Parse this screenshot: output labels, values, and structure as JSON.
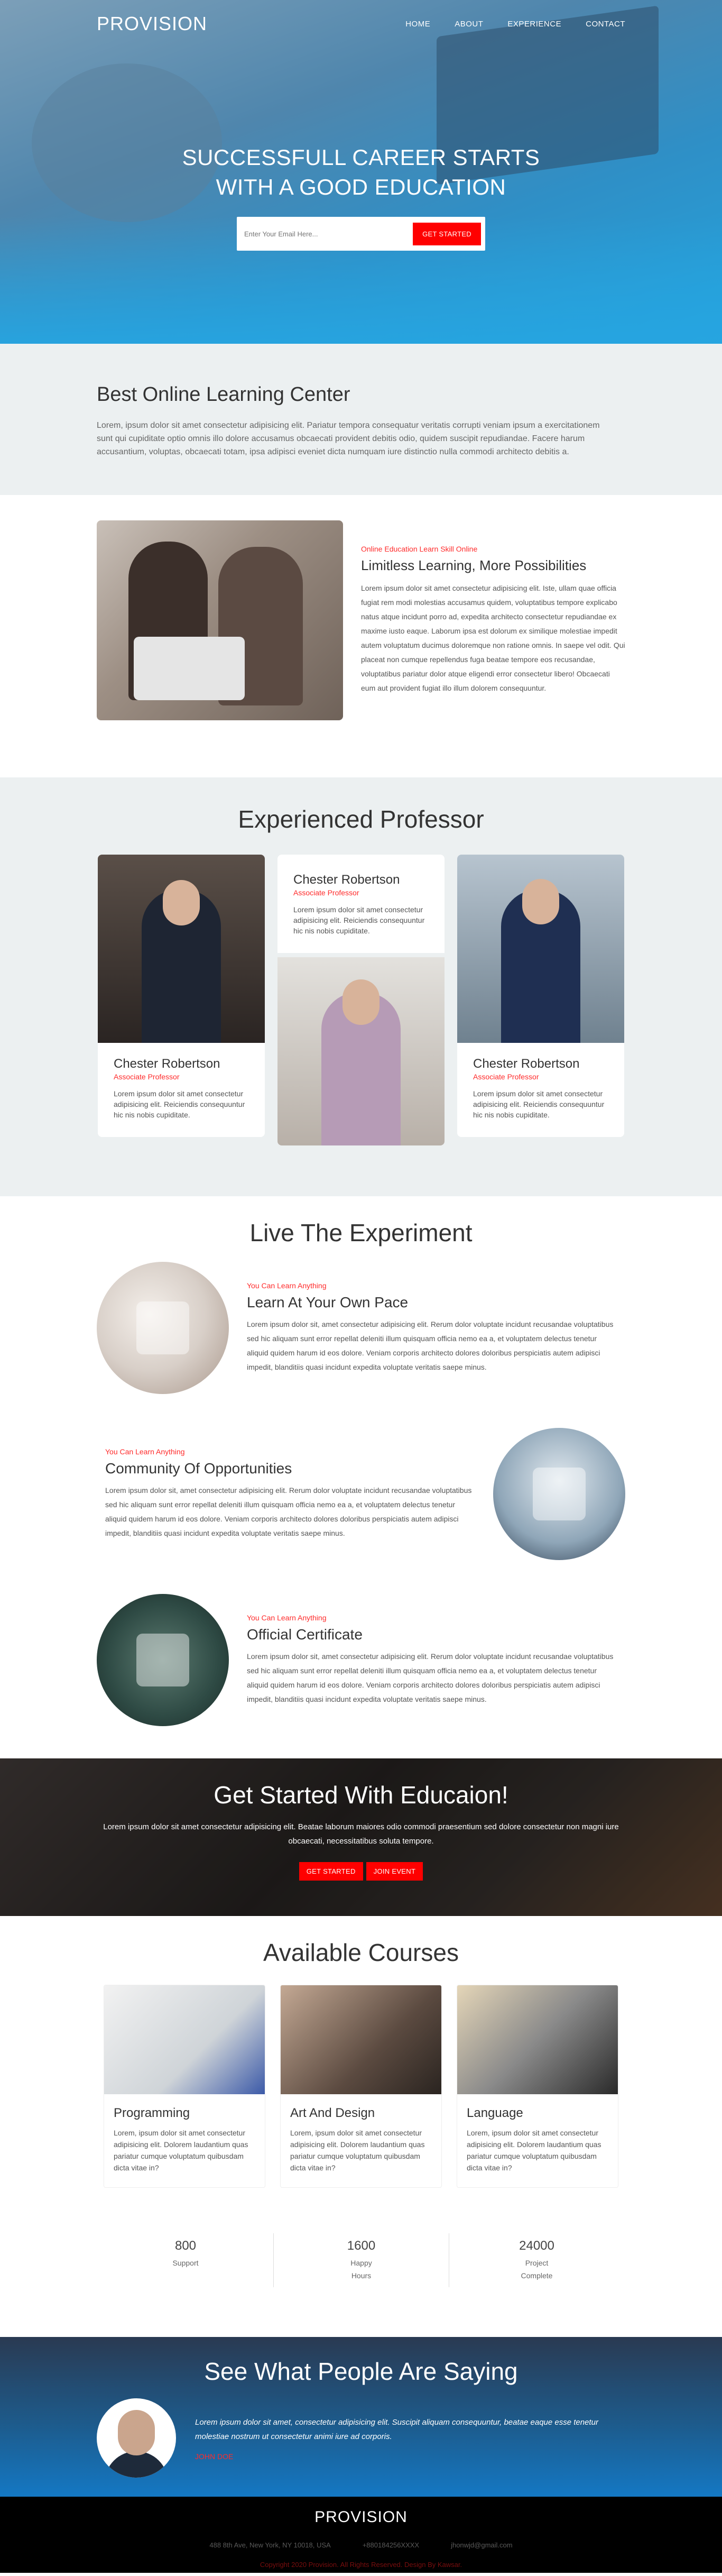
{
  "nav": {
    "logo": "PROVISION",
    "items": [
      "HOME",
      "ABOUT",
      "EXPERIENCE",
      "CONTACT"
    ]
  },
  "hero": {
    "title_line1": "SUCCESSFULL CAREER STARTS",
    "title_line2": "WITH A GOOD EDUCATION",
    "email_placeholder": "Enter Your Email Here...",
    "cta": "GET STARTED"
  },
  "online": {
    "title": "Best Online Learning Center",
    "text": "Lorem, ipsum dolor sit amet consectetur adipisicing elit. Pariatur tempora consequatur veritatis corrupti veniam ipsum a exercitationem sunt qui cupiditate optio omnis illo dolore accusamus obcaecati provident debitis odio, quidem suscipit repudiandae. Facere harum accusantium, voluptas, obcaecati totam, ipsa adipisci eveniet dicta numquam iure distinctio nulla commodi architecto debitis a."
  },
  "limitless": {
    "eyebrow": "Online Education Learn Skill Online",
    "title": "Limitless Learning, More Possibilities",
    "text": "Lorem ipsum dolor sit amet consectetur adipisicing elit. Iste, ullam quae officia fugiat rem modi molestias accusamus quidem, voluptatibus tempore explicabo natus atque incidunt porro ad, expedita architecto consectetur repudiandae ex maxime iusto eaque. Laborum ipsa est dolorum ex similique molestiae impedit autem voluptatum ducimus doloremque non ratione omnis. In saepe vel odit. Qui placeat non cumque repellendus fuga beatae tempore eos recusandae, voluptatibus pariatur dolor atque eligendi error consectetur libero! Obcaecati eum aut provident fugiat illo illum dolorem consequuntur."
  },
  "professors": {
    "title": "Experienced Professor",
    "items": [
      {
        "name": "Chester Robertson",
        "role": "Associate Professor",
        "text": "Lorem ipsum dolor sit amet consectetur adipisicing elit. Reiciendis consequuntur hic nis nobis cupiditate."
      },
      {
        "name": "Chester Robertson",
        "role": "Associate Professor",
        "text": "Lorem ipsum dolor sit amet consectetur adipisicing elit. Reiciendis consequuntur hic nis nobis cupiditate."
      },
      {
        "name": "Chester Robertson",
        "role": "Associate Professor",
        "text": "Lorem ipsum dolor sit amet consectetur adipisicing elit. Reiciendis consequuntur hic nis nobis cupiditate."
      }
    ]
  },
  "experiment": {
    "title": "Live The Experiment",
    "items": [
      {
        "eyebrow": "You Can Learn Anything",
        "title": "Learn At Your Own Pace",
        "text": "Lorem ipsum dolor sit, amet consectetur adipisicing elit. Rerum dolor voluptate incidunt recusandae voluptatibus sed hic aliquam sunt error repellat deleniti illum quisquam officia nemo ea a, et voluptatem delectus tenetur aliquid quidem harum id eos dolore. Veniam corporis architecto dolores doloribus perspiciatis autem adipisci impedit, blanditiis quasi incidunt expedita voluptate veritatis saepe minus."
      },
      {
        "eyebrow": "You Can Learn Anything",
        "title": "Community Of Opportunities",
        "text": "Lorem ipsum dolor sit, amet consectetur adipisicing elit. Rerum dolor voluptate incidunt recusandae voluptatibus sed hic aliquam sunt error repellat deleniti illum quisquam officia nemo ea a, et voluptatem delectus tenetur aliquid quidem harum id eos dolore. Veniam corporis architecto dolores doloribus perspiciatis autem adipisci impedit, blanditiis quasi incidunt expedita voluptate veritatis saepe minus."
      },
      {
        "eyebrow": "You Can Learn Anything",
        "title": "Official Certificate",
        "text": "Lorem ipsum dolor sit, amet consectetur adipisicing elit. Rerum dolor voluptate incidunt recusandae voluptatibus sed hic aliquam sunt error repellat deleniti illum quisquam officia nemo ea a, et voluptatem delectus tenetur aliquid quidem harum id eos dolore. Veniam corporis architecto dolores doloribus perspiciatis autem adipisci impedit, blanditiis quasi incidunt expedita voluptate veritatis saepe minus."
      }
    ]
  },
  "getstarted": {
    "title": "Get Started With Educaion!",
    "text": "Lorem ipsum dolor sit amet consectetur adipisicing elit. Beatae laborum maiores odio commodi praesentium sed dolore consectetur non magni iure obcaecati, necessitatibus soluta tempore.",
    "btn1": "GET STARTED",
    "btn2": "JOIN EVENT"
  },
  "courses": {
    "title": "Available Courses",
    "items": [
      {
        "title": "Programming",
        "text": "Lorem, ipsum dolor sit amet consectetur adipisicing elit. Dolorem laudantium quas pariatur cumque voluptatum quibusdam dicta vitae in?"
      },
      {
        "title": "Art And Design",
        "text": "Lorem, ipsum dolor sit amet consectetur adipisicing elit. Dolorem laudantium quas pariatur cumque voluptatum quibusdam dicta vitae in?"
      },
      {
        "title": "Language",
        "text": "Lorem, ipsum dolor sit amet consectetur adipisicing elit. Dolorem laudantium quas pariatur cumque voluptatum quibusdam dicta vitae in?"
      }
    ]
  },
  "stats": [
    {
      "num": "800",
      "label": "Support"
    },
    {
      "num": "1600",
      "label": "Happy Hours"
    },
    {
      "num": "24000",
      "label": "Project Complete"
    }
  ],
  "testimonial": {
    "title": "See What People Are Saying",
    "quote": "Lorem ipsum dolor sit amet, consectetur adipisicing elit. Suscipit aliquam consequuntur, beatae eaque esse tenetur molestiae nostrum ut consectetur animi iure ad corporis.",
    "name": "JOHN DOE"
  },
  "footer": {
    "logo": "PROVISION",
    "address": "488 8th Ave, New York, NY 10018, USA",
    "phone": "+880184256XXXX",
    "email": "jhonwjd@gmail.com",
    "copyright": "Copyright 2020 Provision. All Rights Reserved. Design By Kawsar."
  },
  "colors": {
    "accent": "#ff0000",
    "hero": "#24a3dd",
    "section_bg": "#ecf0f1"
  }
}
